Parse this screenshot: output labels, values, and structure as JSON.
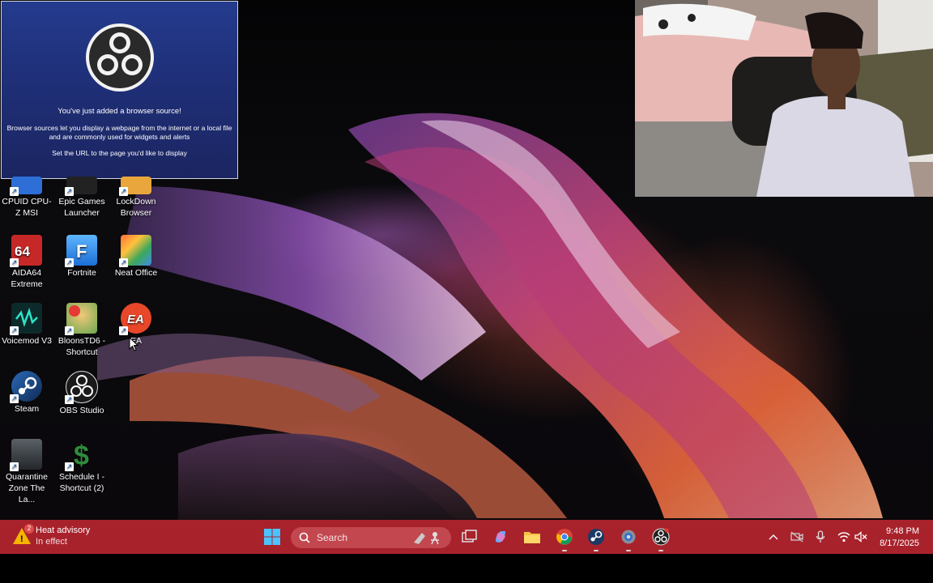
{
  "obs_dialog": {
    "title": "You've just added a browser source!",
    "description": "Browser sources let you display a webpage from the internet or a local file and are commonly used for widgets and alerts",
    "instruction": "Set the URL to the page you'd like to display"
  },
  "desktop_icons": [
    {
      "label": "CPUID CPU-Z MSI",
      "icon": "cpuz-icon",
      "color": "#2d6fd6"
    },
    {
      "label": "Epic Games Launcher",
      "icon": "epic-games-icon",
      "color": "#222222"
    },
    {
      "label": "LockDown Browser",
      "icon": "lockdown-browser-icon",
      "color": "#e8a63c"
    },
    {
      "label": "AIDA64 Extreme",
      "icon": "aida64-icon",
      "color": "#c62828"
    },
    {
      "label": "Fortnite",
      "icon": "fortnite-icon",
      "color": "#2b8ce6"
    },
    {
      "label": "Neat Office",
      "icon": "neat-office-icon",
      "color": "#3d8ee8"
    },
    {
      "label": "Voicemod V3",
      "icon": "voicemod-icon",
      "color": "#0d2a2a"
    },
    {
      "label": "BloonsTD6 - Shortcut",
      "icon": "bloons-icon",
      "color": "#6aa84f"
    },
    {
      "label": "EA",
      "icon": "ea-icon",
      "color": "#e8472a"
    },
    {
      "label": "Steam",
      "icon": "steam-icon",
      "color": "#1b4f8a"
    },
    {
      "label": "OBS Studio",
      "icon": "obs-icon",
      "color": "#1a1a1a"
    },
    {
      "label": "Quarantine Zone The La...",
      "icon": "quarantine-zone-icon",
      "color": "#3a3f44"
    },
    {
      "label": "Schedule I - Shortcut (2)",
      "icon": "schedule-i-icon",
      "color": "#2e8b3a"
    }
  ],
  "taskbar": {
    "weather_title": "Heat advisory",
    "weather_subtitle": "In effect",
    "weather_badge": "2",
    "search_label": "Search",
    "time": "9:48 PM",
    "date": "8/17/2025",
    "accent": "#a8222c"
  }
}
